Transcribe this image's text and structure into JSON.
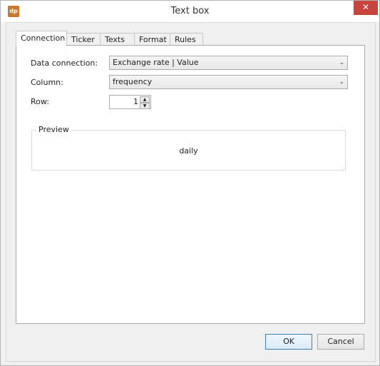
{
  "window": {
    "title": "Text box",
    "app_icon_text": "dp",
    "close_glyph": "✕"
  },
  "tabs": [
    {
      "label": "Connection",
      "active": true
    },
    {
      "label": "Ticker",
      "active": false
    },
    {
      "label": "Texts",
      "active": false
    },
    {
      "label": "Format",
      "active": false
    },
    {
      "label": "Rules",
      "active": false
    }
  ],
  "form": {
    "data_connection": {
      "label": "Data connection:",
      "value": "Exchange rate | Value"
    },
    "column": {
      "label": "Column:",
      "value": "frequency"
    },
    "row": {
      "label": "Row:",
      "value": "1",
      "up_glyph": "▲",
      "down_glyph": "▼"
    },
    "chevron_glyph": "⌄"
  },
  "preview": {
    "legend": "Preview",
    "text": "daily"
  },
  "buttons": {
    "ok": "OK",
    "cancel": "Cancel"
  }
}
